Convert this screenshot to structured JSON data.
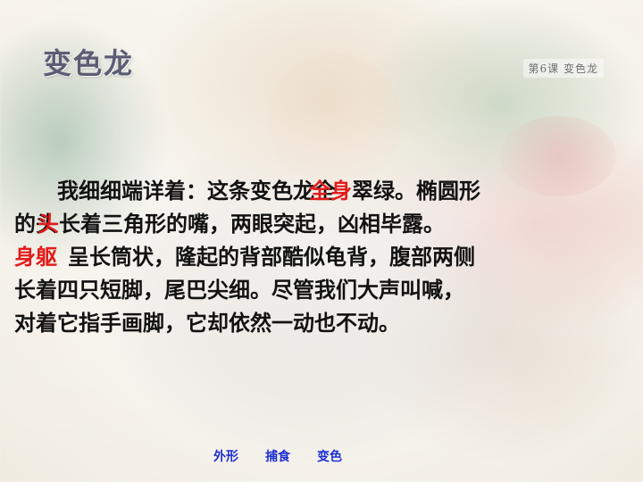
{
  "slide": {
    "title": "变色龙",
    "lesson_tag": "第6课  变色龙"
  },
  "passage": {
    "l1_a": "我细细端详着：这条变色龙全",
    "l1_overlay_under": "身",
    "l1_overlay_red": "全身",
    "l1_b": "翠绿。椭圆形",
    "l2_a": "的头",
    "l2_red_under": "头",
    "l2_red_over": "头",
    "l2_b": "长着三角形的嘴，两眼突起，凶相毕露。",
    "l3_red": "身躯",
    "l3_b": "呈长筒状，隆起的背部酷似龟背，腹部两侧",
    "l4": "长着四只短脚，尾巴尖细。尽管我们大声叫喊，",
    "l5": "对着它指手画脚，它却依然一动也不动。"
  },
  "links": [
    "外形",
    "捕食",
    "变色"
  ],
  "colors": {
    "title": "#5b5d74",
    "highlight": "#e31b1b",
    "link": "#1c2fd1"
  }
}
